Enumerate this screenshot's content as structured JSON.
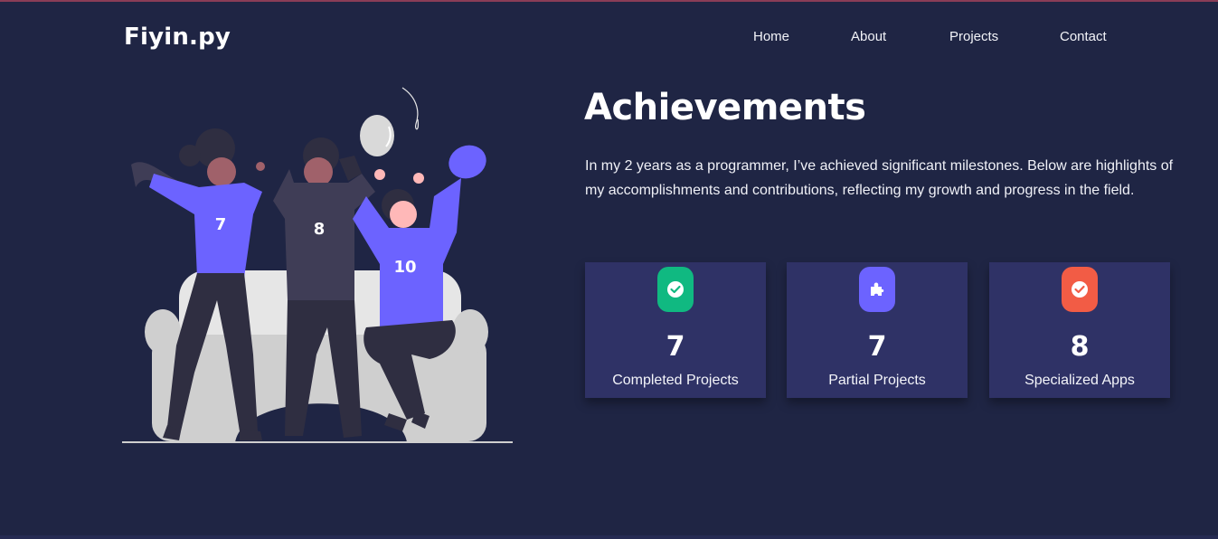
{
  "header": {
    "logo": "Fiyin.py",
    "nav": [
      {
        "label": "Home"
      },
      {
        "label": "About"
      },
      {
        "label": "Projects"
      },
      {
        "label": "Contact"
      }
    ]
  },
  "illustration": {
    "jersey_numbers": [
      "7",
      "8",
      "10"
    ]
  },
  "main": {
    "title": "Achievements",
    "intro": "In my 2 years as a programmer, I’ve achieved significant milestones. Below are highlights of my accomplishments and contributions, reflecting my growth and progress in the field.",
    "stats": [
      {
        "value": "7",
        "label": "Completed Projects",
        "icon": "check-circle-icon",
        "color": "#10b981"
      },
      {
        "value": "7",
        "label": "Partial Projects",
        "icon": "puzzle-icon",
        "color": "#6c63ff"
      },
      {
        "value": "8",
        "label": "Specialized Apps",
        "icon": "check-circle-icon",
        "color": "#f25c45"
      }
    ]
  },
  "colors": {
    "background": "#1f2544",
    "card": "#2f3266",
    "accent": "#6c63ff"
  }
}
